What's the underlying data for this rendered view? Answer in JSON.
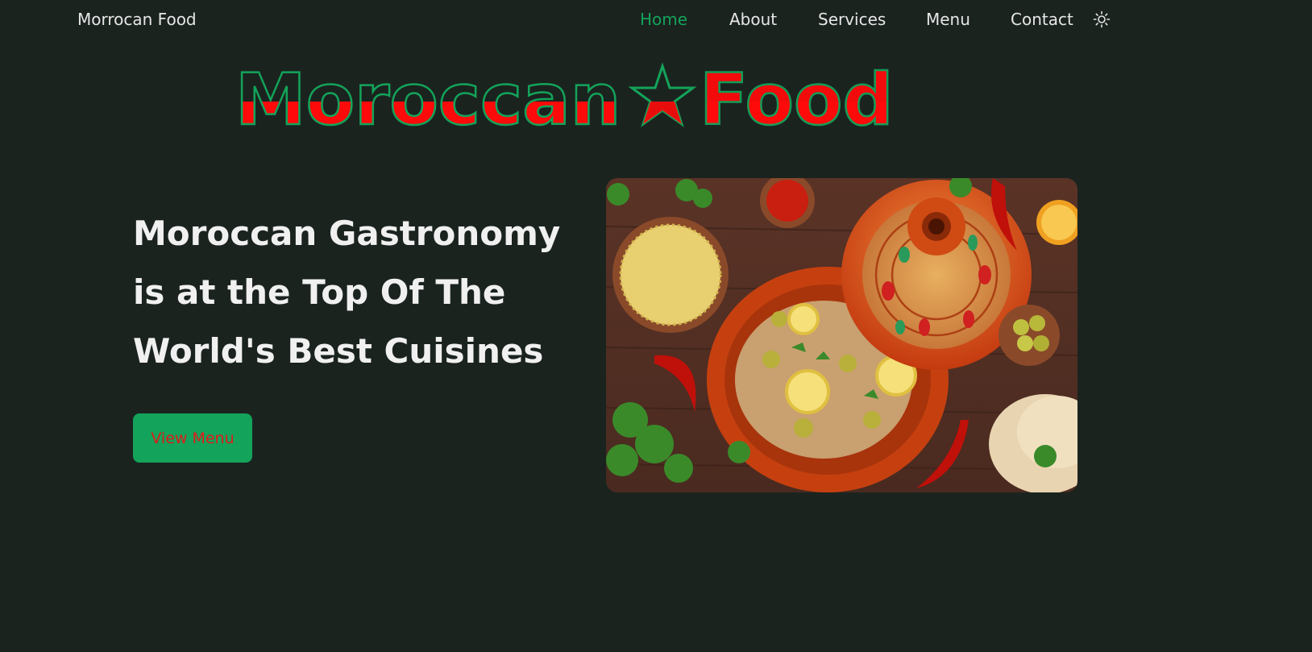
{
  "nav": {
    "brand": "Morrocan Food",
    "links": [
      "Home",
      "About",
      "Services",
      "Menu",
      "Contact"
    ],
    "active": "Home",
    "theme_icon": "sun-icon"
  },
  "logo": {
    "word1": "Moroccan",
    "word2": "Food",
    "star_icon": "star-icon",
    "colors": {
      "green": "#13a35a",
      "red": "#ff0a0a"
    }
  },
  "hero": {
    "title_lines": [
      "Moroccan Gastronomy",
      "is at the Top Of The",
      "World's Best Cuisines"
    ],
    "button": "View Menu",
    "image_subject": "tagine-dish-photo"
  },
  "colors": {
    "background": "#1b231f",
    "accent": "#13a35a",
    "red": "#e01b1b",
    "text": "#f0f0f0"
  }
}
